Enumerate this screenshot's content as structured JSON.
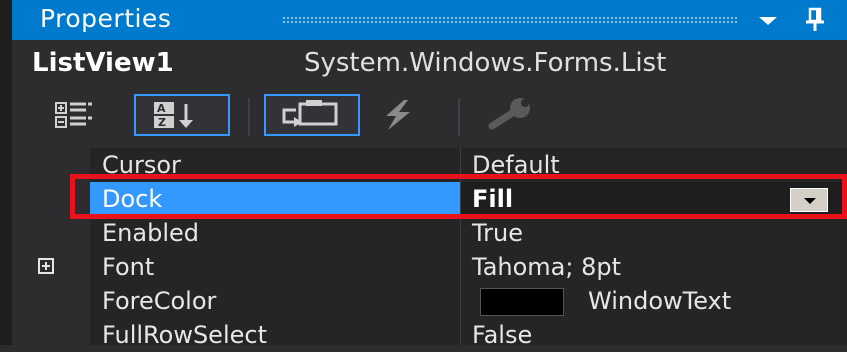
{
  "window": {
    "title": "Properties"
  },
  "object_selector": {
    "name": "ListView1",
    "type": "System.Windows.Forms.List"
  },
  "toolbar": {
    "buttons": [
      {
        "icon": "categorized-icon",
        "selected": false
      },
      {
        "icon": "alphabetical-sort-icon",
        "selected": true
      },
      {
        "icon": "properties-icon",
        "selected": true
      },
      {
        "icon": "events-lightning-icon",
        "selected": false
      },
      {
        "icon": "property-pages-wrench-icon",
        "selected": false,
        "disabled": true
      }
    ]
  },
  "properties": [
    {
      "name": "Cursor",
      "value": "Default"
    },
    {
      "name": "Dock",
      "value": "Fill",
      "selected": true
    },
    {
      "name": "Enabled",
      "value": "True"
    },
    {
      "name": "Font",
      "value": "Tahoma; 8pt",
      "expandable": true
    },
    {
      "name": "ForeColor",
      "value": "WindowText",
      "swatch_color": "#000000"
    },
    {
      "name": "FullRowSelect",
      "value": "False"
    }
  ],
  "colors": {
    "title_bar": "#007acc",
    "selection": "#3399ff",
    "highlight_outline": "#e8121c"
  }
}
